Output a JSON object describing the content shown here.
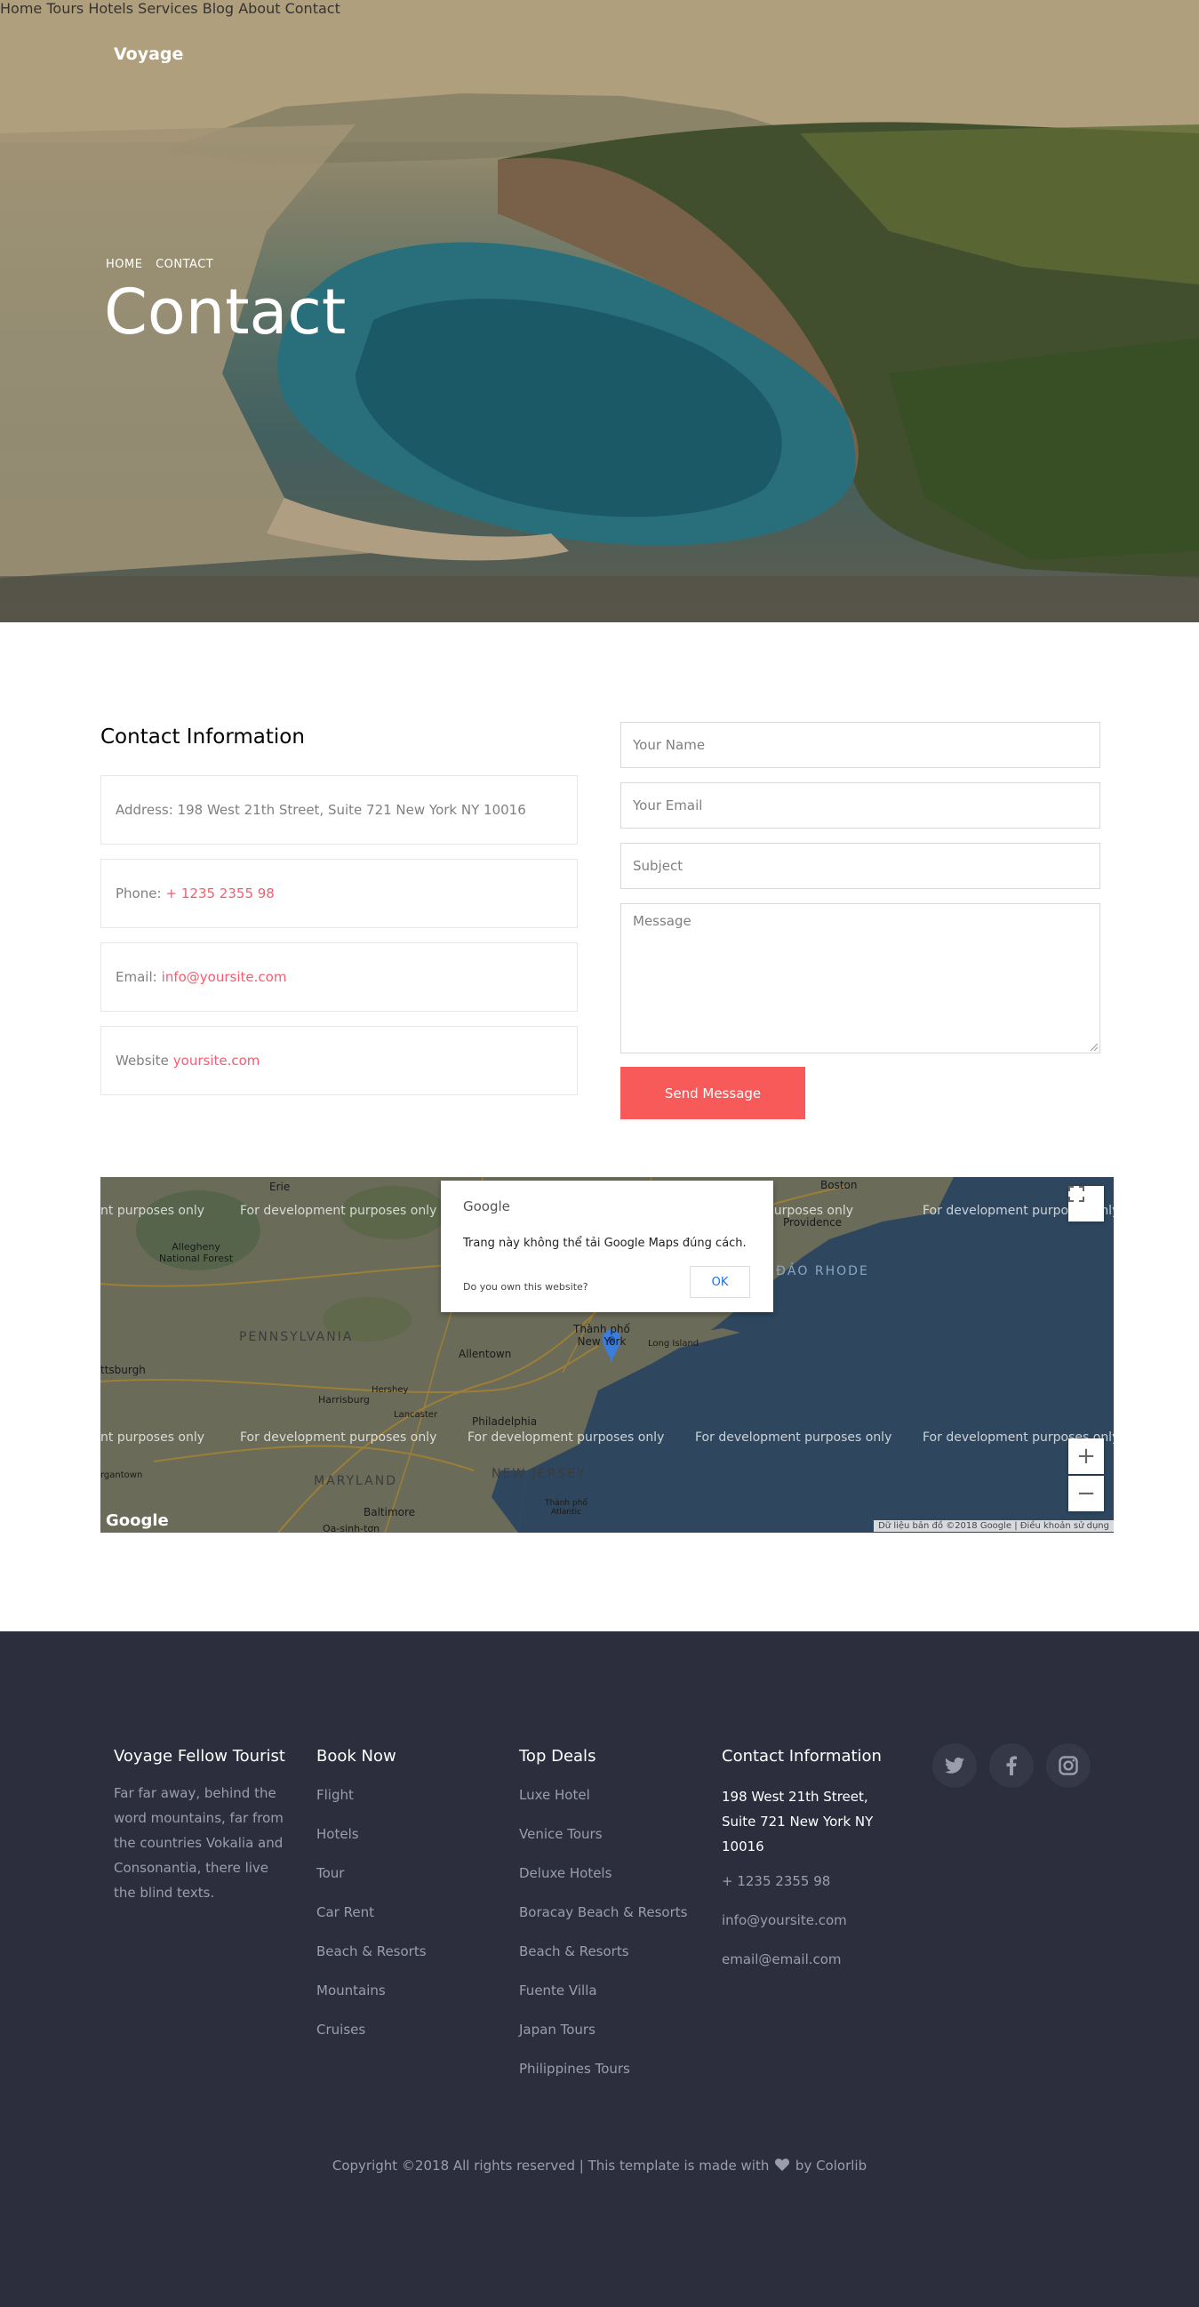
{
  "nav": {
    "brand": "Voyage",
    "items": [
      {
        "label": "Home"
      },
      {
        "label": "Tours"
      },
      {
        "label": "Hotels"
      },
      {
        "label": "Services"
      },
      {
        "label": "Blog"
      },
      {
        "label": "About"
      },
      {
        "label": "Contact",
        "active": true
      }
    ]
  },
  "hero": {
    "breadcrumb": [
      "HOME",
      "CONTACT"
    ],
    "title": "Contact"
  },
  "contact_info": {
    "title": "Contact Information",
    "address": "Address: 198 West 21th Street, Suite 721 New York NY 10016",
    "phone_label": "Phone:",
    "phone_value": "+ 1235 2355 98",
    "email_label": "Email:",
    "email_value": "info@yoursite.com",
    "website_label": "Website",
    "website_value": "yoursite.com"
  },
  "form": {
    "name_placeholder": "Your Name",
    "email_placeholder": "Your Email",
    "subject_placeholder": "Subject",
    "message_placeholder": "Message",
    "submit_label": "Send Message"
  },
  "map": {
    "watermark": "For development purposes only",
    "watermark_partial_left": "nt purposes only",
    "watermark_partial_right": "For development purposes only",
    "dialog": {
      "logo": "Google",
      "message": "Trang này không thể tải Google Maps đúng cách.",
      "own_site": "Do you own this website?",
      "ok": "OK"
    },
    "labels": {
      "erie": "Erie",
      "boston": "Boston",
      "providence": "Providence",
      "allegheny": "Allegheny\nNational Forest",
      "pennsylvania": "PENNSYLVANIA",
      "rhode": "ĐẢO RHODE",
      "pittsburgh": "ttsburgh",
      "allentown": "Allentown",
      "newyork": "Thành phố\nNew York",
      "longisland": "Long Island",
      "harrisburg": "Harrisburg",
      "hershey": "Hershey",
      "lancaster": "Lancaster",
      "philadelphia": "Philadelphia",
      "newjersey": "NEW JERSEY",
      "maryland": "MARYLAND",
      "baltimore": "Baltimore",
      "morgantown": "rgantown",
      "trenton": "Thành phố\nAtlantic",
      "dc": "Oa-sinh-tơn"
    },
    "google": "Google",
    "attribution": "Dữ liệu bản đồ ©2018 Google  |  Điều khoản sử dụng",
    "fullscreen_icon": "fullscreen-icon",
    "zoom_in": "+",
    "zoom_out": "−"
  },
  "footer": {
    "col1": {
      "title": "Voyage Fellow Tourist",
      "text": "Far far away, behind the word mountains, far from the countries Vokalia and Consonantia, there live the blind texts."
    },
    "col2": {
      "title": "Book Now",
      "links": [
        "Flight",
        "Hotels",
        "Tour",
        "Car Rent",
        "Beach & Resorts",
        "Mountains",
        "Cruises"
      ]
    },
    "col3": {
      "title": "Top Deals",
      "links": [
        "Luxe Hotel",
        "Venice Tours",
        "Deluxe Hotels",
        "Boracay Beach & Resorts",
        "Beach & Resorts",
        "Fuente Villa",
        "Japan Tours",
        "Philippines Tours"
      ]
    },
    "col4": {
      "title": "Contact Information",
      "address": "198 West 21th Street, Suite 721 New York NY 10016",
      "phone": "+ 1235 2355 98",
      "email1": "info@yoursite.com",
      "email2": "email@email.com"
    },
    "social": [
      "twitter-icon",
      "facebook-icon",
      "instagram-icon"
    ],
    "copyright_prefix": "Copyright ©2018 All rights reserved | This template is made with",
    "copyright_suffix": "by Colorlib"
  }
}
